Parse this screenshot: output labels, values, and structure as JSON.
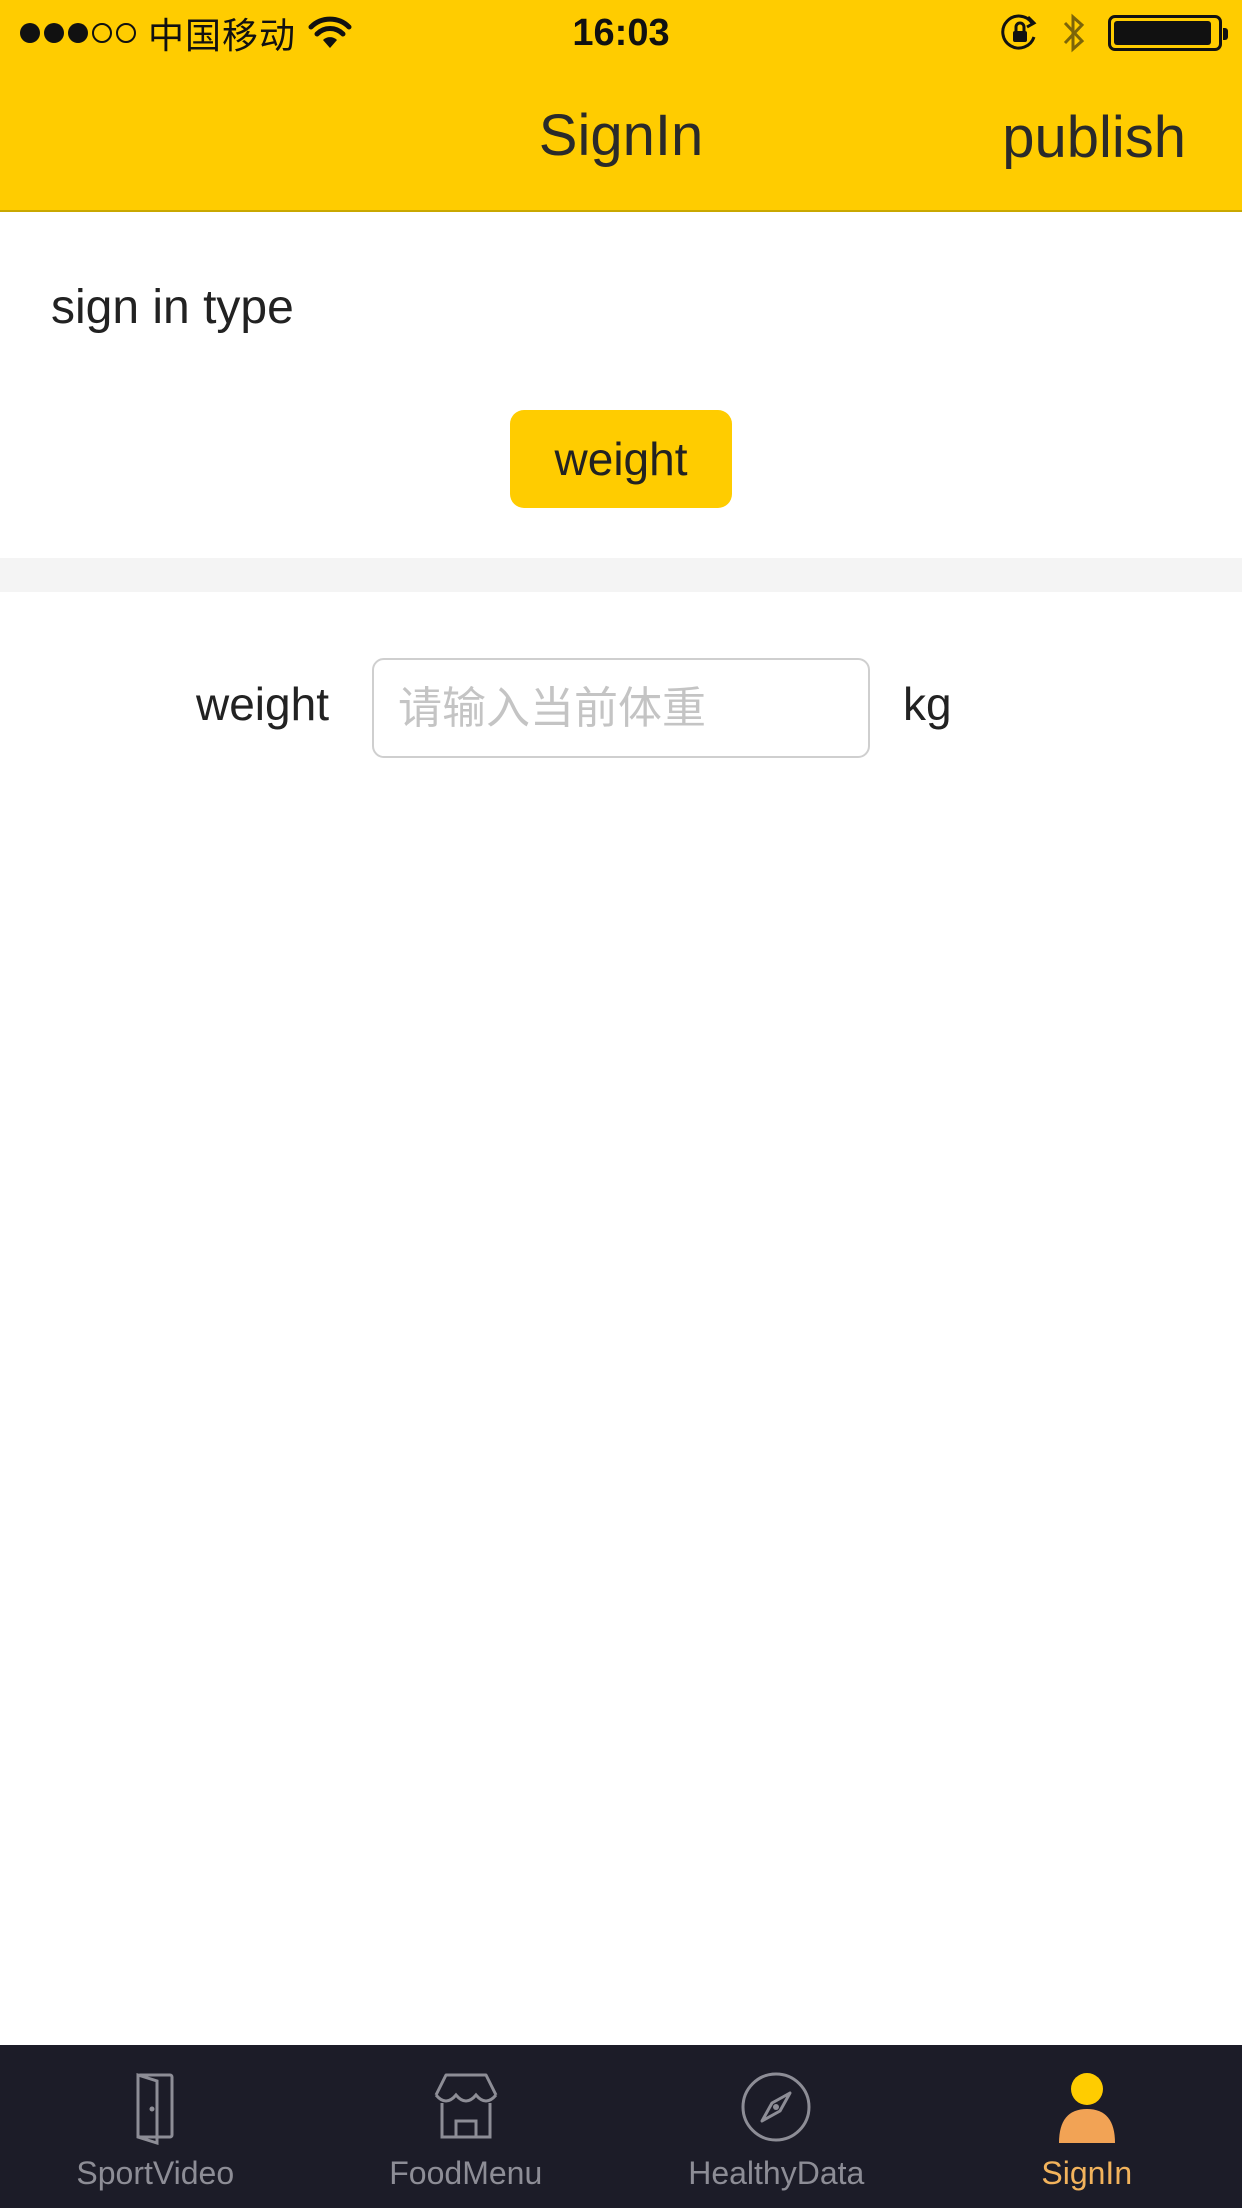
{
  "status_bar": {
    "carrier": "中国移动",
    "time": "16:03",
    "signal_bars_filled": 3,
    "signal_bars_total": 5,
    "battery_level": 0.95
  },
  "nav": {
    "title": "SignIn",
    "action_label": "publish"
  },
  "sign_in_type": {
    "label": "sign in type",
    "selected_option": "weight"
  },
  "weight_form": {
    "label": "weight",
    "value": "",
    "placeholder": "请输入当前体重",
    "unit": "kg"
  },
  "tabbar": {
    "tabs": [
      {
        "label": "SportVideo",
        "icon": "door-icon",
        "active": false
      },
      {
        "label": "FoodMenu",
        "icon": "shop-icon",
        "active": false
      },
      {
        "label": "HealthyData",
        "icon": "compass-icon",
        "active": false
      },
      {
        "label": "SignIn",
        "icon": "user-icon",
        "active": true
      }
    ]
  },
  "colors": {
    "accent": "#FFCC00",
    "tabbar_bg": "#1c1c28",
    "tab_active": "#f2b35c",
    "tab_inactive": "#8d8d96"
  }
}
